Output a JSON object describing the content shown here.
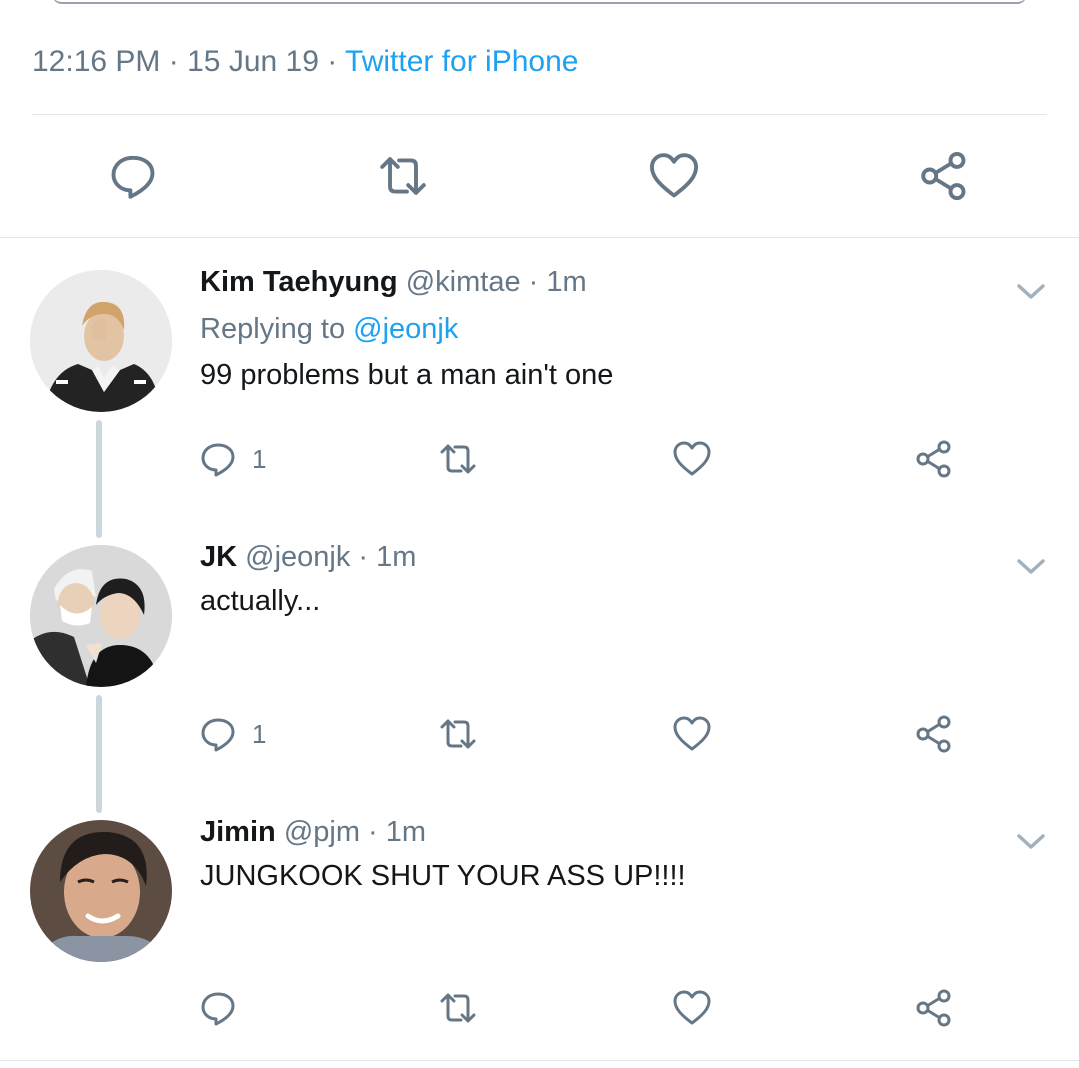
{
  "tweet_detail": {
    "time": "12:16 PM",
    "separator": "·",
    "date": "15 Jun 19",
    "source": "Twitter for iPhone"
  },
  "main_actions": {
    "reply_icon": "reply-icon",
    "retweet_icon": "retweet-icon",
    "like_icon": "heart-icon",
    "share_icon": "share-icon"
  },
  "replies": [
    {
      "name": "Kim Taehyung",
      "handle": "@kimtae",
      "separator": "·",
      "time": "1m",
      "replying_prefix": "Replying to ",
      "replying_to": "@jeonjk",
      "text": "99 problems but a man ain't one",
      "reply_count": "1",
      "avatar_colors": {
        "bg": "#e9e9ea",
        "accent": "#2a2a2a"
      }
    },
    {
      "name": "JK",
      "handle": "@jeonjk",
      "separator": "·",
      "time": "1m",
      "text": "actually...",
      "reply_count": "1",
      "avatar_colors": {
        "bg": "#d8d8d8",
        "accent": "#1c1c1c"
      }
    },
    {
      "name": "Jimin",
      "handle": "@pjm",
      "separator": "·",
      "time": "1m",
      "text": "JUNGKOOK SHUT YOUR ASS UP!!!!",
      "reply_count": "",
      "avatar_colors": {
        "bg": "#6d5a4e",
        "accent": "#2b2622"
      }
    }
  ],
  "colors": {
    "link_blue": "#1da1f2",
    "secondary_text": "#657786",
    "icon_gray": "#657786",
    "divider": "#e1e8ed",
    "thread_line": "#ccd6dd"
  }
}
